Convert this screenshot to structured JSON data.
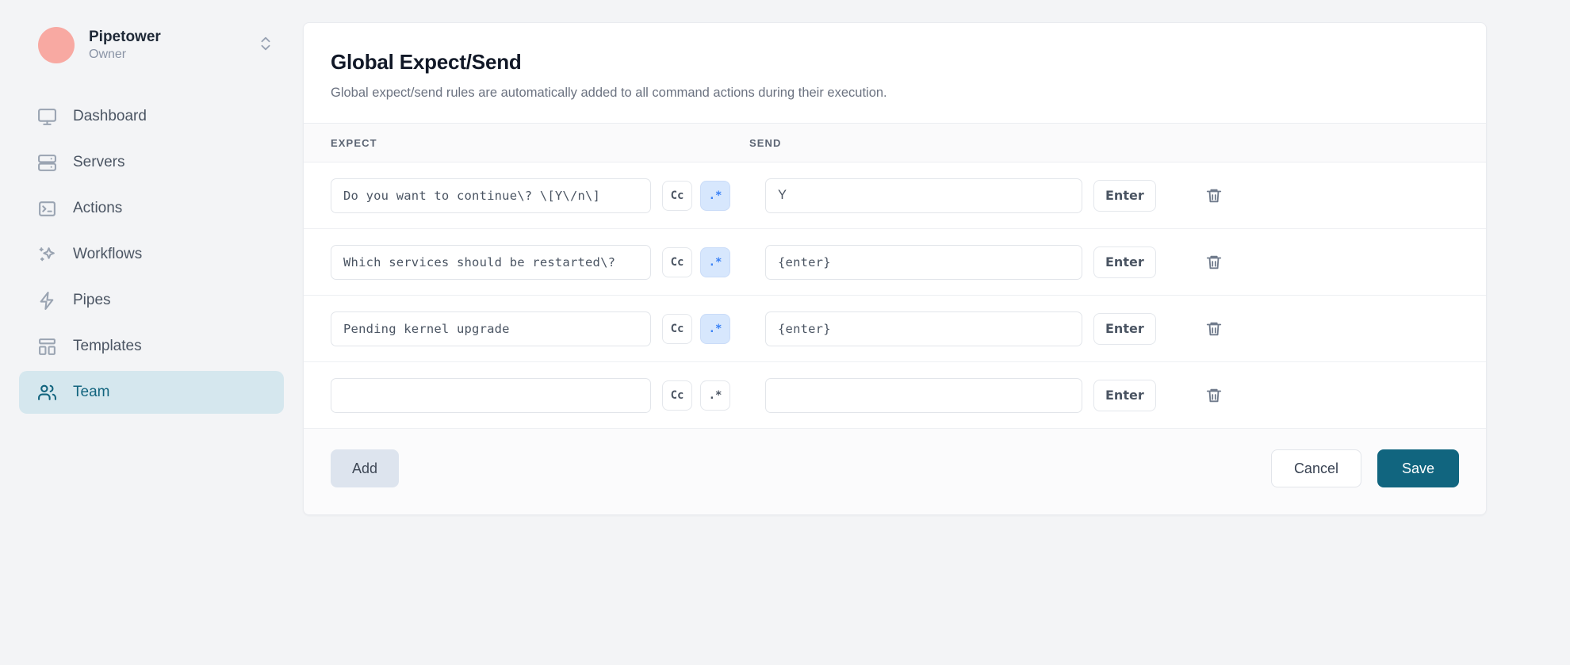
{
  "sidebar": {
    "org": {
      "name": "Pipetower",
      "role": "Owner",
      "switcher_icon": "chevrons-up-down-icon",
      "avatar": "org-avatar",
      "avatar_color": "#f8a9a2"
    },
    "items": [
      {
        "label": "Dashboard",
        "icon": "monitor-icon",
        "active": false
      },
      {
        "label": "Servers",
        "icon": "server-icon",
        "active": false
      },
      {
        "label": "Actions",
        "icon": "terminal-icon",
        "active": false
      },
      {
        "label": "Workflows",
        "icon": "sparkles-icon",
        "active": false
      },
      {
        "label": "Pipes",
        "icon": "zap-icon",
        "active": false
      },
      {
        "label": "Templates",
        "icon": "layout-dashboard-icon",
        "active": false
      },
      {
        "label": "Team",
        "icon": "users-icon",
        "active": true
      }
    ],
    "active_bg": "#d5e7ee",
    "active_fg": "#12647e"
  },
  "card": {
    "title": "Global Expect/Send",
    "subtitle": "Global expect/send rules are automatically added to all command actions during their execution.",
    "columns": {
      "expect": "EXPECT",
      "send": "SEND"
    },
    "rows": [
      {
        "expect": "Do you want to continue\\? \\[Y\\/n\\]",
        "case_label": "Cc",
        "case_on": false,
        "regex_label": ".*",
        "regex_on": true,
        "send": "Y",
        "send_mono": false,
        "enter_label": "Enter",
        "delete_icon": "trash-icon"
      },
      {
        "expect": "Which services should be restarted\\?",
        "case_label": "Cc",
        "case_on": false,
        "regex_label": ".*",
        "regex_on": true,
        "send": "{enter}",
        "send_mono": true,
        "enter_label": "Enter",
        "delete_icon": "trash-icon"
      },
      {
        "expect": "Pending kernel upgrade",
        "case_label": "Cc",
        "case_on": false,
        "regex_label": ".*",
        "regex_on": true,
        "send": "{enter}",
        "send_mono": true,
        "enter_label": "Enter",
        "delete_icon": "trash-icon"
      },
      {
        "expect": "",
        "case_label": "Cc",
        "case_on": false,
        "regex_label": ".*",
        "regex_on": false,
        "send": "",
        "send_mono": false,
        "enter_label": "Enter",
        "delete_icon": "trash-icon"
      }
    ],
    "footer": {
      "add": "Add",
      "cancel": "Cancel",
      "save": "Save",
      "save_color": "#11657f"
    }
  }
}
